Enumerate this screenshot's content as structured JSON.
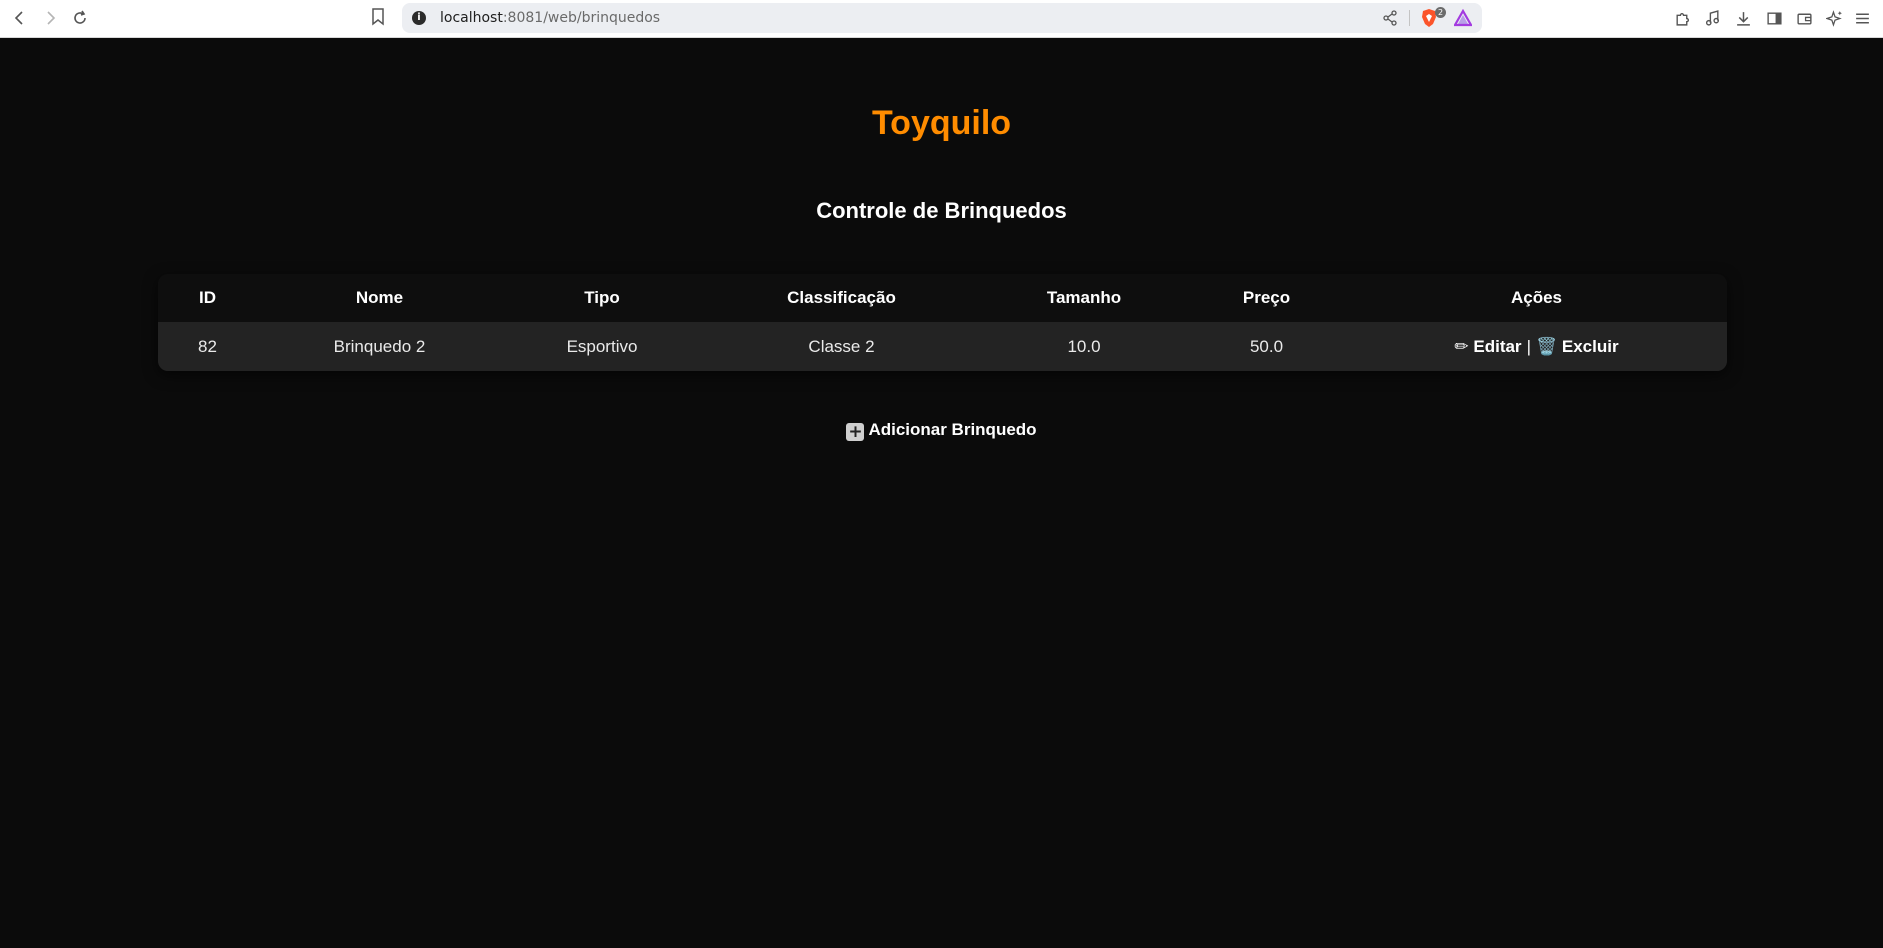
{
  "browser": {
    "url_host": "localhost",
    "url_path": ":8081/web/brinquedos",
    "shields_badge": "2"
  },
  "page": {
    "brand": "Toyquilo",
    "subtitle": "Controle de Brinquedos",
    "brand_color": "#ff8c00",
    "background_color": "#0b0b0b"
  },
  "table": {
    "headers": {
      "id": "ID",
      "nome": "Nome",
      "tipo": "Tipo",
      "classificacao": "Classificação",
      "tamanho": "Tamanho",
      "preco": "Preço",
      "acoes": "Ações"
    },
    "rows": [
      {
        "id": "82",
        "nome": "Brinquedo 2",
        "tipo": "Esportivo",
        "classificacao": "Classe 2",
        "tamanho": "10.0",
        "preco": "50.0",
        "edit_emoji": "✏",
        "edit_label": "Editar",
        "separator": "|",
        "delete_emoji": "🗑️",
        "delete_label": "Excluir"
      }
    ]
  },
  "add_button": {
    "emoji": "+",
    "label": "Adicionar Brinquedo"
  }
}
